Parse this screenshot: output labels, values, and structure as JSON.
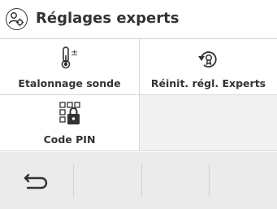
{
  "header": {
    "title": "Réglages experts",
    "icon": "expert-settings-icon"
  },
  "tiles": [
    {
      "label": "Etalonnage sonde",
      "icon": "thermometer-plus-minus-icon"
    },
    {
      "label": "Réinit. régl. Experts",
      "icon": "reset-expert-icon"
    },
    {
      "label": "Code PIN",
      "icon": "pin-lock-icon"
    }
  ],
  "footer": {
    "back_icon": "back-arrow-icon"
  },
  "colors": {
    "text": "#333333",
    "divider": "#d7d7d7",
    "empty_tile": "#f1f1f1",
    "footer_bg": "#ebebeb"
  }
}
